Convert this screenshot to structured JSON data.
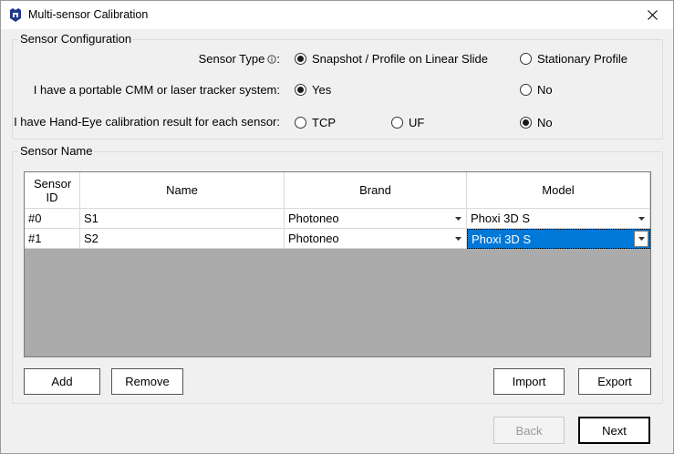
{
  "window": {
    "title": "Multi-sensor Calibration"
  },
  "sensor_configuration": {
    "legend": "Sensor Configuration",
    "sensor_type": {
      "label": "Sensor Type",
      "options": [
        "Snapshot / Profile on Linear Slide",
        "Stationary Profile"
      ],
      "selected": "Snapshot / Profile on Linear Slide"
    },
    "cmm": {
      "label": "I have a portable CMM or laser tracker system:",
      "options": [
        "Yes",
        "No"
      ],
      "selected": "Yes"
    },
    "hand_eye": {
      "label": "I have Hand-Eye calibration result for each sensor:",
      "options": [
        "TCP",
        "UF",
        "No"
      ],
      "selected": "No"
    }
  },
  "sensor_name": {
    "legend": "Sensor Name",
    "columns": [
      "Sensor ID",
      "Name",
      "Brand",
      "Model"
    ],
    "rows": [
      {
        "id": "#0",
        "name": "S1",
        "brand": "Photoneo",
        "model": "Phoxi 3D S"
      },
      {
        "id": "#1",
        "name": "S2",
        "brand": "Photoneo",
        "model": "Phoxi 3D S"
      }
    ],
    "selected_cell": {
      "row": 1,
      "column": "Model"
    },
    "buttons": {
      "add": "Add",
      "remove": "Remove",
      "import": "Import",
      "export": "Export"
    }
  },
  "footer": {
    "back": "Back",
    "next": "Next"
  },
  "colors": {
    "selection": "#0078d7",
    "grid_background": "#ababab",
    "dialog_background": "#f0f0f0"
  }
}
